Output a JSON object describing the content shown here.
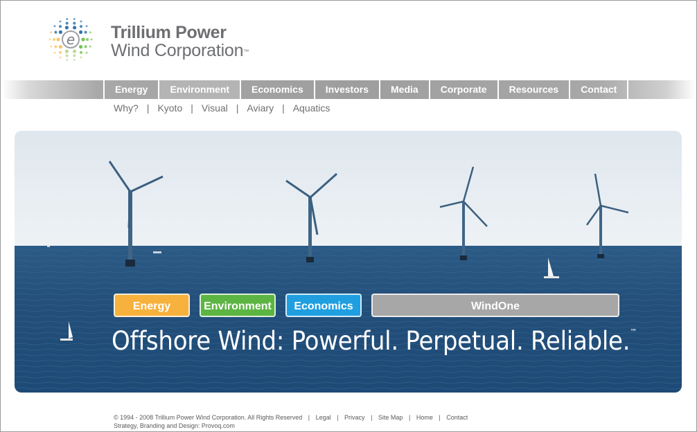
{
  "logo": {
    "line1": "Trillium Power",
    "line2": "Wind Corporation",
    "tm": "™",
    "mark_letter": "e"
  },
  "nav": {
    "items": [
      {
        "label": "Energy"
      },
      {
        "label": "Environment",
        "active": true
      },
      {
        "label": "Economics"
      },
      {
        "label": "Investors"
      },
      {
        "label": "Media"
      },
      {
        "label": "Corporate"
      },
      {
        "label": "Resources"
      },
      {
        "label": "Contact"
      }
    ]
  },
  "subnav": {
    "items": [
      "Why?",
      "Kyoto",
      "Visual",
      "Aviary",
      "Aquatics"
    ],
    "separator": "|"
  },
  "hero": {
    "buttons": {
      "energy": "Energy",
      "environment": "Environment",
      "economics": "Economics",
      "windone": "WindOne"
    },
    "tagline": "Offshore Wind: Powerful. Perpetual. Reliable.",
    "tagline_tm": "™",
    "colors": {
      "energy": "#f7b13d",
      "environment": "#5cb542",
      "economics": "#1f9fe0",
      "windone": "#a7a7a7"
    }
  },
  "footer": {
    "copyright": "© 1994 - 2008 Trillium Power Wind Corporation. All Rights Reserved",
    "links": [
      "Legal",
      "Privacy",
      "Site Map",
      "Home",
      "Contact"
    ],
    "separator": "|",
    "credit": "Strategy, Branding and Design: Provoq.com"
  }
}
